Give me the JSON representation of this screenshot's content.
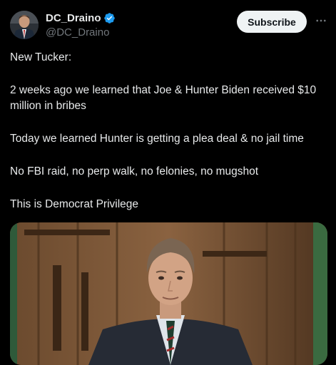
{
  "author": {
    "display_name": "DC_Draino",
    "handle": "@DC_Draino",
    "verified": true
  },
  "actions": {
    "subscribe_label": "Subscribe",
    "more_icon": "more-horizontal-icon"
  },
  "tweet": {
    "paragraphs": [
      "New Tucker:",
      "2 weeks ago we learned that Joe & Hunter Biden received $10 million in bribes",
      "Today we learned Hunter is getting a plea deal & no jail time",
      "No FBI raid, no perp walk, no felonies, no mugshot",
      "This is Democrat Privilege"
    ]
  },
  "colors": {
    "background": "#000000",
    "text": "#e7e9ea",
    "secondary_text": "#71767b",
    "verified_badge": "#1d9bf0",
    "subscribe_bg": "#eff3f4"
  }
}
